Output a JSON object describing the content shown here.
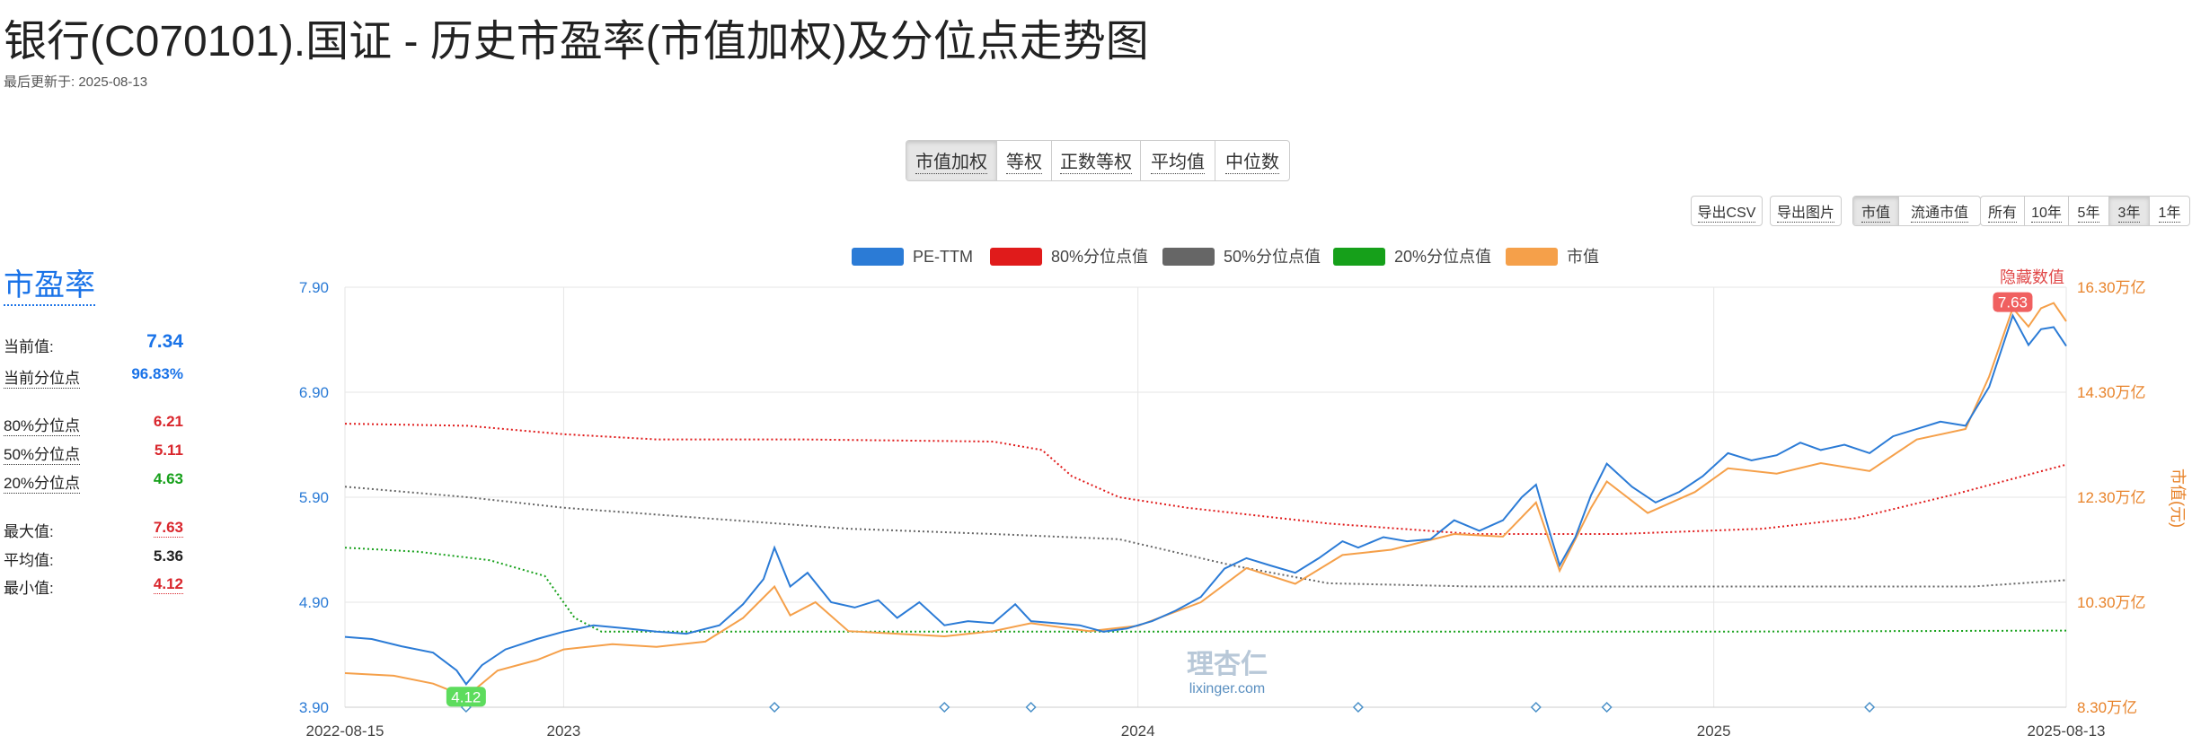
{
  "page": {
    "title": "银行(C070101).国证 - 历史市盈率(市值加权)及分位点走势图",
    "updated": "最后更新于: 2025-08-13"
  },
  "weight_tabs": [
    {
      "label": "市值加权",
      "active": true
    },
    {
      "label": "等权",
      "active": false
    },
    {
      "label": "正数等权",
      "active": false
    },
    {
      "label": "平均值",
      "active": false
    },
    {
      "label": "中位数",
      "active": false
    }
  ],
  "toolbar": {
    "export_csv": "导出CSV",
    "export_image": "导出图片",
    "market_cap": [
      {
        "label": "市值",
        "active": true
      },
      {
        "label": "流通市值",
        "active": false
      }
    ],
    "periods": [
      {
        "label": "所有",
        "active": false
      },
      {
        "label": "10年",
        "active": false
      },
      {
        "label": "5年",
        "active": false
      },
      {
        "label": "3年",
        "active": true
      },
      {
        "label": "1年",
        "active": false
      }
    ]
  },
  "sidebar": {
    "title": "市盈率",
    "current_label": "当前值:",
    "current_value": "7.34",
    "current_pct_label": "当前分位点",
    "current_pct_value": "96.83%",
    "p80_label": "80%分位点",
    "p80_value": "6.21",
    "p50_label": "50%分位点",
    "p50_value": "5.11",
    "p20_label": "20%分位点",
    "p20_value": "4.63",
    "max_label": "最大值:",
    "max_value": "7.63",
    "avg_label": "平均值:",
    "avg_value": "5.36",
    "min_label": "最小值:",
    "min_value": "4.12"
  },
  "colors": {
    "pe": "#2b7bd6",
    "p80": "#e01b1b",
    "p50": "#666666",
    "p20": "#16a01a",
    "mcap": "#f5a04a",
    "max_badge": "#f06060",
    "min_badge": "#5ddc5d",
    "right_axis": "#e8832a",
    "left_axis": "#2b7bd6"
  },
  "chart_data": {
    "type": "line",
    "legend": [
      "PE-TTM",
      "80%分位点值",
      "50%分位点值",
      "20%分位点值",
      "市值"
    ],
    "hide_values_label": "隐藏数值",
    "watermark": "理杏仁",
    "watermark_sub": "lixinger.com",
    "right_axis_label": "市值(元)",
    "x_range": [
      "2022-08-15",
      "2025-08-13"
    ],
    "x_ticks": [
      "2022-08-15",
      "2023",
      "2024",
      "2025",
      "2025-08-13"
    ],
    "x_tick_dates": [
      "2022-08-15",
      "2023-01-01",
      "2024-01-01",
      "2025-01-01",
      "2025-08-13"
    ],
    "y_left": {
      "min": 3.9,
      "max": 7.9,
      "ticks": [
        "3.90",
        "4.90",
        "5.90",
        "6.90",
        "7.90"
      ]
    },
    "y_right": {
      "min": 8.3,
      "max": 16.3,
      "unit": "万亿",
      "ticks": [
        "8.30万亿",
        "10.30万亿",
        "12.30万亿",
        "14.30万亿",
        "16.30万亿"
      ]
    },
    "max_point": {
      "date": "2025-07-10",
      "value": 7.63,
      "label": "7.63"
    },
    "min_point": {
      "date": "2022-10-31",
      "value": 4.12,
      "label": "4.12"
    },
    "event_markers": [
      "2022-10-31",
      "2023-05-15",
      "2023-08-31",
      "2023-10-25",
      "2024-05-20",
      "2024-09-10",
      "2024-10-25",
      "2025-04-10"
    ],
    "pe_ttm": [
      [
        "2022-08-15",
        4.57
      ],
      [
        "2022-09-01",
        4.55
      ],
      [
        "2022-09-20",
        4.48
      ],
      [
        "2022-10-10",
        4.42
      ],
      [
        "2022-10-25",
        4.25
      ],
      [
        "2022-10-31",
        4.12
      ],
      [
        "2022-11-10",
        4.3
      ],
      [
        "2022-11-25",
        4.45
      ],
      [
        "2022-12-15",
        4.55
      ],
      [
        "2023-01-01",
        4.62
      ],
      [
        "2023-01-20",
        4.68
      ],
      [
        "2023-02-10",
        4.65
      ],
      [
        "2023-03-01",
        4.62
      ],
      [
        "2023-03-20",
        4.6
      ],
      [
        "2023-04-10",
        4.68
      ],
      [
        "2023-04-25",
        4.88
      ],
      [
        "2023-05-08",
        5.12
      ],
      [
        "2023-05-15",
        5.42
      ],
      [
        "2023-05-25",
        5.05
      ],
      [
        "2023-06-05",
        5.18
      ],
      [
        "2023-06-20",
        4.9
      ],
      [
        "2023-07-05",
        4.85
      ],
      [
        "2023-07-20",
        4.92
      ],
      [
        "2023-08-01",
        4.75
      ],
      [
        "2023-08-15",
        4.9
      ],
      [
        "2023-08-31",
        4.68
      ],
      [
        "2023-09-15",
        4.72
      ],
      [
        "2023-10-01",
        4.7
      ],
      [
        "2023-10-15",
        4.88
      ],
      [
        "2023-10-25",
        4.72
      ],
      [
        "2023-11-10",
        4.7
      ],
      [
        "2023-11-25",
        4.68
      ],
      [
        "2023-12-10",
        4.62
      ],
      [
        "2023-12-25",
        4.65
      ],
      [
        "2024-01-10",
        4.72
      ],
      [
        "2024-01-25",
        4.82
      ],
      [
        "2024-02-10",
        4.95
      ],
      [
        "2024-02-25",
        5.22
      ],
      [
        "2024-03-10",
        5.32
      ],
      [
        "2024-03-25",
        5.25
      ],
      [
        "2024-04-10",
        5.18
      ],
      [
        "2024-04-25",
        5.32
      ],
      [
        "2024-05-10",
        5.48
      ],
      [
        "2024-05-20",
        5.42
      ],
      [
        "2024-06-05",
        5.52
      ],
      [
        "2024-06-20",
        5.48
      ],
      [
        "2024-07-05",
        5.5
      ],
      [
        "2024-07-20",
        5.68
      ],
      [
        "2024-08-05",
        5.58
      ],
      [
        "2024-08-20",
        5.68
      ],
      [
        "2024-09-01",
        5.9
      ],
      [
        "2024-09-10",
        6.02
      ],
      [
        "2024-09-18",
        5.6
      ],
      [
        "2024-09-25",
        5.25
      ],
      [
        "2024-10-05",
        5.52
      ],
      [
        "2024-10-15",
        5.92
      ],
      [
        "2024-10-25",
        6.22
      ],
      [
        "2024-11-10",
        6.0
      ],
      [
        "2024-11-25",
        5.85
      ],
      [
        "2024-12-10",
        5.95
      ],
      [
        "2024-12-25",
        6.1
      ],
      [
        "2025-01-10",
        6.32
      ],
      [
        "2025-01-25",
        6.25
      ],
      [
        "2025-02-10",
        6.3
      ],
      [
        "2025-02-25",
        6.42
      ],
      [
        "2025-03-10",
        6.35
      ],
      [
        "2025-03-25",
        6.4
      ],
      [
        "2025-04-10",
        6.32
      ],
      [
        "2025-04-25",
        6.48
      ],
      [
        "2025-05-10",
        6.55
      ],
      [
        "2025-05-25",
        6.62
      ],
      [
        "2025-06-10",
        6.58
      ],
      [
        "2025-06-25",
        6.95
      ],
      [
        "2025-07-10",
        7.63
      ],
      [
        "2025-07-20",
        7.35
      ],
      [
        "2025-07-28",
        7.5
      ],
      [
        "2025-08-05",
        7.52
      ],
      [
        "2025-08-13",
        7.34
      ]
    ],
    "market_cap": [
      [
        "2022-08-15",
        8.95
      ],
      [
        "2022-09-15",
        8.9
      ],
      [
        "2022-10-10",
        8.75
      ],
      [
        "2022-10-31",
        8.5
      ],
      [
        "2022-11-20",
        9.0
      ],
      [
        "2022-12-15",
        9.2
      ],
      [
        "2023-01-01",
        9.4
      ],
      [
        "2023-02-01",
        9.5
      ],
      [
        "2023-03-01",
        9.45
      ],
      [
        "2023-04-01",
        9.55
      ],
      [
        "2023-04-25",
        10.0
      ],
      [
        "2023-05-15",
        10.6
      ],
      [
        "2023-05-25",
        10.05
      ],
      [
        "2023-06-10",
        10.3
      ],
      [
        "2023-07-01",
        9.75
      ],
      [
        "2023-08-01",
        9.7
      ],
      [
        "2023-08-31",
        9.65
      ],
      [
        "2023-10-01",
        9.75
      ],
      [
        "2023-10-25",
        9.9
      ],
      [
        "2023-12-01",
        9.75
      ],
      [
        "2024-01-01",
        9.85
      ],
      [
        "2024-02-10",
        10.3
      ],
      [
        "2024-03-10",
        10.95
      ],
      [
        "2024-04-10",
        10.65
      ],
      [
        "2024-05-10",
        11.2
      ],
      [
        "2024-06-10",
        11.3
      ],
      [
        "2024-07-20",
        11.6
      ],
      [
        "2024-08-20",
        11.55
      ],
      [
        "2024-09-10",
        12.2
      ],
      [
        "2024-09-25",
        10.9
      ],
      [
        "2024-10-15",
        12.1
      ],
      [
        "2024-10-25",
        12.6
      ],
      [
        "2024-11-20",
        12.0
      ],
      [
        "2024-12-20",
        12.4
      ],
      [
        "2025-01-10",
        12.85
      ],
      [
        "2025-02-10",
        12.75
      ],
      [
        "2025-03-10",
        12.95
      ],
      [
        "2025-04-10",
        12.8
      ],
      [
        "2025-05-10",
        13.4
      ],
      [
        "2025-06-10",
        13.6
      ],
      [
        "2025-06-25",
        14.6
      ],
      [
        "2025-07-10",
        15.9
      ],
      [
        "2025-07-20",
        15.55
      ],
      [
        "2025-07-28",
        15.9
      ],
      [
        "2025-08-05",
        16.0
      ],
      [
        "2025-08-13",
        15.65
      ]
    ],
    "p80": [
      [
        "2022-08-15",
        6.6
      ],
      [
        "2022-11-01",
        6.58
      ],
      [
        "2023-01-01",
        6.5
      ],
      [
        "2023-03-01",
        6.45
      ],
      [
        "2023-06-01",
        6.45
      ],
      [
        "2023-10-01",
        6.43
      ],
      [
        "2023-11-01",
        6.35
      ],
      [
        "2023-11-20",
        6.1
      ],
      [
        "2023-12-20",
        5.9
      ],
      [
        "2024-02-01",
        5.8
      ],
      [
        "2024-05-01",
        5.65
      ],
      [
        "2024-08-01",
        5.55
      ],
      [
        "2024-11-01",
        5.55
      ],
      [
        "2025-02-01",
        5.6
      ],
      [
        "2025-04-01",
        5.7
      ],
      [
        "2025-06-01",
        5.92
      ],
      [
        "2025-08-13",
        6.21
      ]
    ],
    "p50": [
      [
        "2022-08-15",
        6.0
      ],
      [
        "2022-11-01",
        5.9
      ],
      [
        "2023-01-01",
        5.8
      ],
      [
        "2023-04-01",
        5.7
      ],
      [
        "2023-07-01",
        5.6
      ],
      [
        "2023-10-01",
        5.55
      ],
      [
        "2023-12-20",
        5.5
      ],
      [
        "2024-03-01",
        5.25
      ],
      [
        "2024-05-01",
        5.08
      ],
      [
        "2024-08-01",
        5.05
      ],
      [
        "2025-01-01",
        5.05
      ],
      [
        "2025-04-01",
        5.05
      ],
      [
        "2025-06-15",
        5.05
      ],
      [
        "2025-07-15",
        5.08
      ],
      [
        "2025-08-13",
        5.11
      ]
    ],
    "p20": [
      [
        "2022-08-15",
        5.42
      ],
      [
        "2022-10-01",
        5.38
      ],
      [
        "2022-11-15",
        5.3
      ],
      [
        "2022-12-20",
        5.15
      ],
      [
        "2023-01-08",
        4.75
      ],
      [
        "2023-01-25",
        4.62
      ],
      [
        "2023-06-01",
        4.62
      ],
      [
        "2024-01-01",
        4.62
      ],
      [
        "2025-01-01",
        4.62
      ],
      [
        "2025-08-13",
        4.63
      ]
    ]
  }
}
